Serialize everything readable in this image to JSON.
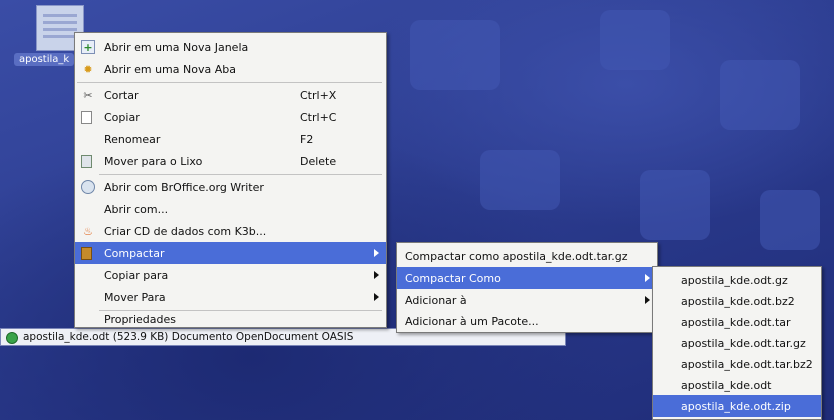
{
  "desktop": {
    "icon_label": "apostila_k",
    "statusbar_text": "apostila_kde.odt (523.9 KB)  Documento OpenDocument OASIS"
  },
  "context_menu": {
    "items": [
      {
        "label": "Abrir em uma Nova Janela",
        "icon": "new-window-icon"
      },
      {
        "label": "Abrir em uma Nova Aba",
        "icon": "new-tab-icon"
      },
      {
        "label": "Cortar",
        "shortcut": "Ctrl+X",
        "icon": "cut-icon"
      },
      {
        "label": "Copiar",
        "shortcut": "Ctrl+C",
        "icon": "copy-icon"
      },
      {
        "label": "Renomear",
        "shortcut": "F2"
      },
      {
        "label": "Mover para o Lixo",
        "shortcut": "Delete",
        "icon": "trash-icon"
      },
      {
        "label": "Abrir com BrOffice.org Writer",
        "icon": "writer-icon"
      },
      {
        "label": "Abrir com..."
      },
      {
        "label": "Criar CD de dados com K3b...",
        "icon": "k3b-icon"
      },
      {
        "label": "Compactar",
        "icon": "archive-icon",
        "highlighted": true
      },
      {
        "label": "Copiar para"
      },
      {
        "label": "Mover Para"
      },
      {
        "label": "Propriedades"
      }
    ]
  },
  "compactar_submenu": {
    "items": [
      {
        "label": "Compactar como apostila_kde.odt.tar.gz"
      },
      {
        "label": "Compactar Como",
        "highlighted": true
      },
      {
        "label": "Adicionar à"
      },
      {
        "label": "Adicionar à um Pacote..."
      }
    ]
  },
  "compactar_como_submenu": {
    "items": [
      {
        "label": "apostila_kde.odt.gz"
      },
      {
        "label": "apostila_kde.odt.bz2"
      },
      {
        "label": "apostila_kde.odt.tar"
      },
      {
        "label": "apostila_kde.odt.tar.gz"
      },
      {
        "label": "apostila_kde.odt.tar.bz2"
      },
      {
        "label": "apostila_kde.odt"
      },
      {
        "label": "apostila_kde.odt.zip",
        "highlighted": true
      }
    ]
  },
  "colors": {
    "highlight": "#4a6dd8",
    "menu_bg": "#f4f4f2",
    "desktop": "#2a3a8c"
  }
}
